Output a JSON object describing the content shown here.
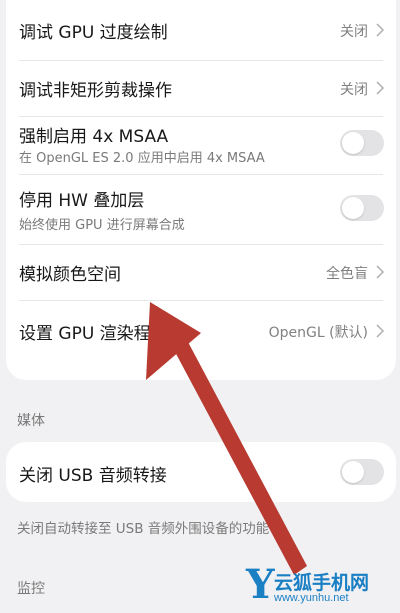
{
  "settings_top": {
    "rows": [
      {
        "title": "调试 GPU 过度绘制",
        "value": "关闭"
      },
      {
        "title": "调试非矩形剪裁操作",
        "value": "关闭"
      },
      {
        "title": "强制启用 4x MSAA",
        "subtitle": "在 OpenGL ES 2.0 应用中启用 4x MSAA",
        "toggle_on": false
      },
      {
        "title": "停用 HW 叠加层",
        "subtitle": "始终使用 GPU 进行屏幕合成",
        "toggle_on": false
      },
      {
        "title": "模拟颜色空间",
        "value": "全色盲"
      },
      {
        "title": "设置 GPU 渲染程序",
        "value": "OpenGL (默认)"
      }
    ]
  },
  "media": {
    "section_label": "媒体",
    "rows": [
      {
        "title": "关闭 USB 音频转接",
        "toggle_on": false
      }
    ],
    "note": "关闭自动转接至 USB 音频外围设备的功能"
  },
  "monitor": {
    "section_label": "监控"
  },
  "annotation": {
    "arrow_color": "#b83a30"
  },
  "watermark": {
    "logo_letter": "Y",
    "name": "云狐手机网",
    "url": "www.yunhu.net",
    "color": "#1b7fc4"
  }
}
